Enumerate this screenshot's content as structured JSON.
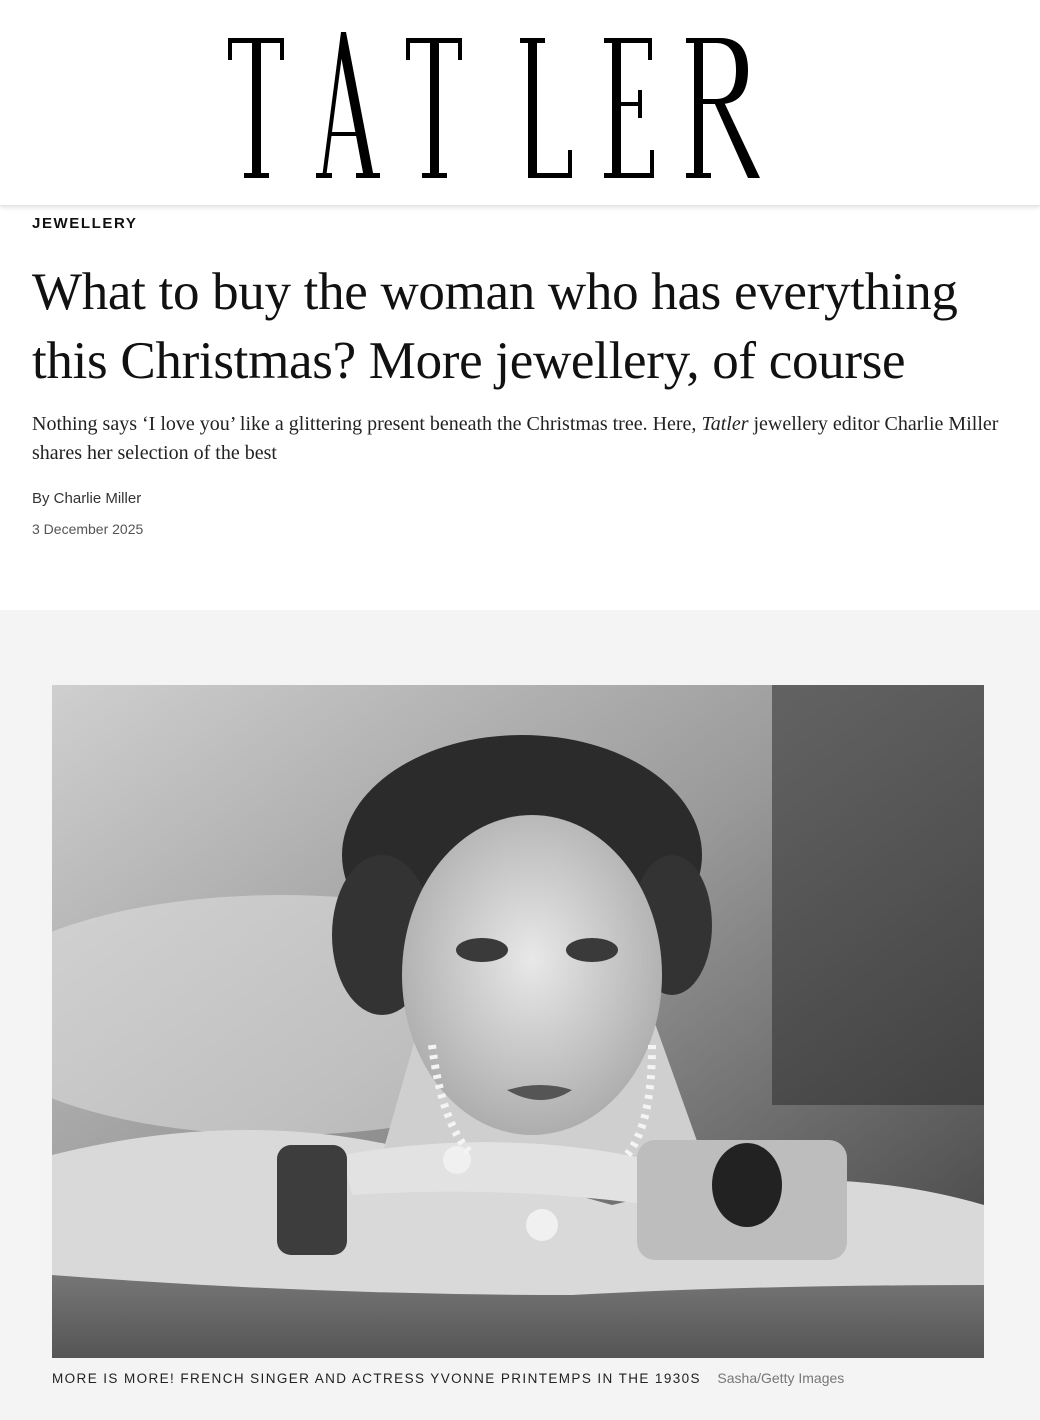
{
  "brand": {
    "logo_text": "TATLER"
  },
  "article": {
    "rubric": "JEWELLERY",
    "headline": "What to buy the woman who has everything this Christmas? More jewellery, of course",
    "dek_before": "Nothing says ‘I love you’ like a glittering present beneath the Christmas tree. Here, ",
    "dek_em": "Tatler",
    "dek_after": " jewellery editor Charlie Miller shares her selection of the best",
    "byline": "By Charlie Miller",
    "date": "3 December 2025"
  },
  "lede_image": {
    "alt": "Black and white portrait of a woman resting her chin on her hands wearing bracelets and rings",
    "caption": "MORE IS MORE! FRENCH SINGER AND ACTRESS YVONNE PRINTEMPS IN THE 1930S",
    "credit": "Sasha/Getty Images"
  },
  "colors": {
    "text": "#111111",
    "lede_background": "#f4f4f4",
    "caption_credit": "#777777"
  }
}
